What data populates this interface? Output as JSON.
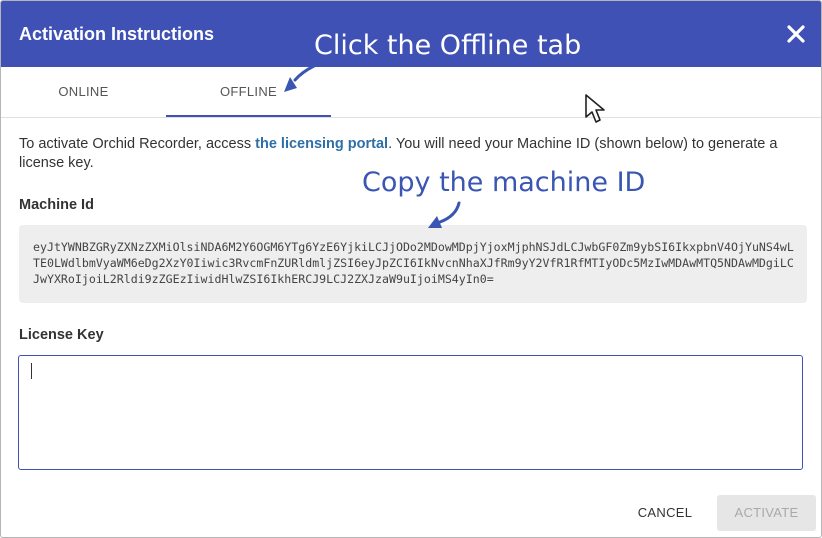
{
  "dialog": {
    "title": "Activation Instructions",
    "close_icon": "close-icon"
  },
  "callouts": {
    "tab": "Click the Offline tab",
    "machine_id": "Copy the machine ID"
  },
  "tabs": [
    {
      "label": "ONLINE",
      "active": false
    },
    {
      "label": "OFFLINE",
      "active": true
    }
  ],
  "intro": {
    "before": "To activate Orchid Recorder, access ",
    "link": "the licensing portal",
    "after": ". You will need your Machine ID (shown below) to generate a license key."
  },
  "machine_id": {
    "label": "Machine Id",
    "value": "eyJtYWNBZGRyZXNzZXMiOlsiNDA6M2Y6OGM6YTg6YzE6YjkiLCJjODo2MDowMDpjYjoxMjphNSJdLCJwbGF0Zm9ybSI6IkxpbnV4OjYuNS4wLTE0LWdlbmVyaWM6eDg2XzY0Iiwic3RvcmFnZURldmljZSI6eyJpZCI6IkNvcnNhaXJfRm9yY2VfR1RfMTIyODc5MzIwMDAwMTQ5NDAwMDgiLCJwYXRoIjoiL2Rldi9zZGEzIiwidHlwZSI6IkhERCJ9LCJ2ZXJzaW9uIjoiMS4yIn0="
  },
  "license_key": {
    "label": "License Key",
    "value": ""
  },
  "actions": {
    "cancel": "CANCEL",
    "activate": "ACTIVATE"
  },
  "colors": {
    "header": "#3f51b5",
    "callout": "#3a55b2",
    "link": "#2e6fa8",
    "disabled_button_bg": "#e6e6e6"
  }
}
